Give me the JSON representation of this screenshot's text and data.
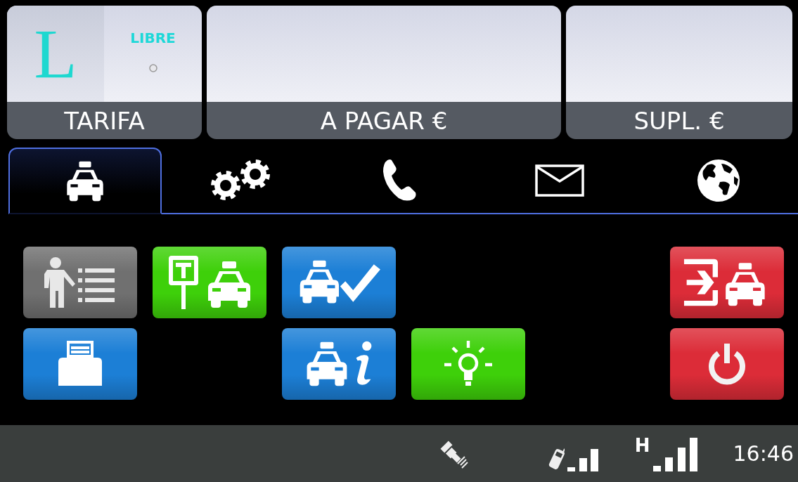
{
  "fare_panels": [
    {
      "kind": "tariff",
      "letter": "L",
      "status": "LIBRE",
      "label": "TARIFA"
    },
    {
      "kind": "amount",
      "label": "A PAGAR €"
    },
    {
      "kind": "amount",
      "label": "SUPL. €"
    }
  ],
  "tabs": [
    {
      "kind": "taxi",
      "selected": true
    },
    {
      "kind": "settings",
      "selected": false
    },
    {
      "kind": "phone",
      "selected": false
    },
    {
      "kind": "mail",
      "selected": false
    },
    {
      "kind": "globe",
      "selected": false
    }
  ],
  "button_rows": [
    [
      {
        "kind": "passenger-list",
        "color": "#707070"
      },
      {
        "kind": "taxi-stand",
        "color": "#3ed00a"
      },
      {
        "kind": "taxi-check",
        "color": "#1c7fd6"
      },
      null,
      null,
      {
        "kind": "taxi-exit",
        "color": "#dc2c38"
      }
    ],
    [
      {
        "kind": "printer",
        "color": "#1c7fd6"
      },
      null,
      {
        "kind": "taxi-info",
        "color": "#1c7fd6"
      },
      {
        "kind": "light",
        "color": "#3ed00a"
      },
      null,
      {
        "kind": "power",
        "color": "#dc2c38"
      }
    ]
  ],
  "status_bar": {
    "network": "H",
    "time": "16:46"
  }
}
